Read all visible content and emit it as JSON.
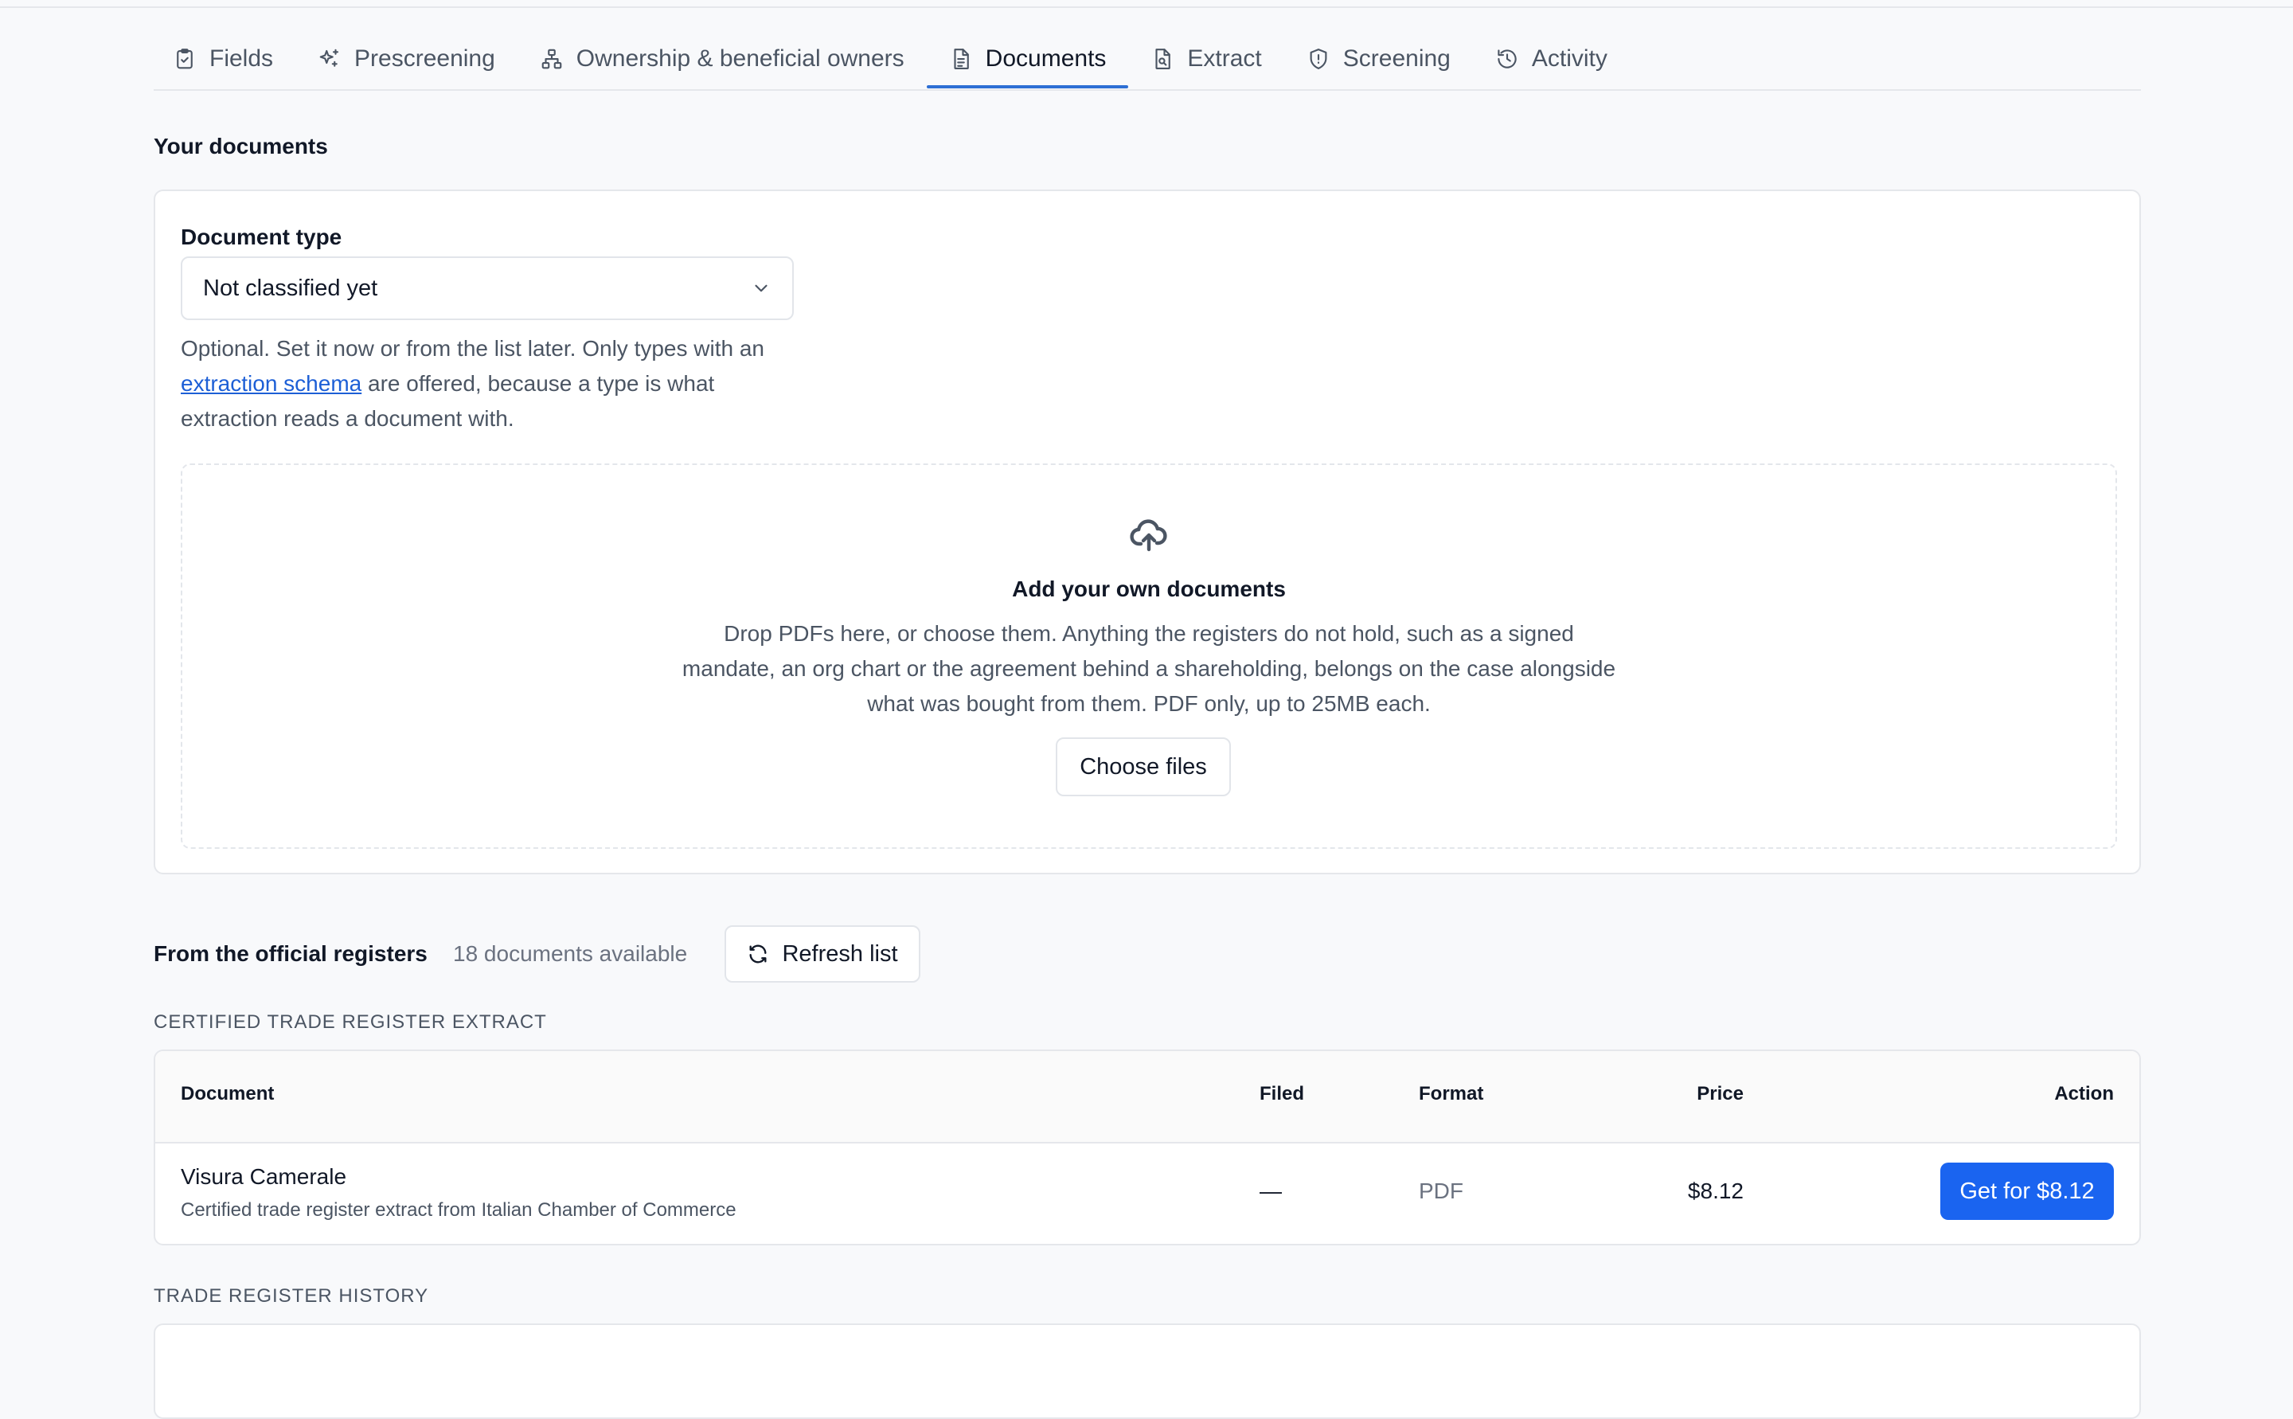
{
  "tabs": [
    {
      "label": "Fields"
    },
    {
      "label": "Prescreening"
    },
    {
      "label": "Ownership & beneficial owners"
    },
    {
      "label": "Documents"
    },
    {
      "label": "Extract"
    },
    {
      "label": "Screening"
    },
    {
      "label": "Activity"
    }
  ],
  "your_documents": {
    "title": "Your documents",
    "document_type_label": "Document type",
    "document_type_value": "Not classified yet",
    "help_before": "Optional. Set it now or from the list later. Only types with an ",
    "help_link": "extraction schema",
    "help_after": " are offered, because a type is what extraction reads a document with.",
    "dropzone": {
      "title": "Add your own documents",
      "text": "Drop PDFs here, or choose them. Anything the registers do not hold, such as a signed mandate, an org chart or the agreement behind a shareholding, belongs on the case alongside what was bought from them. PDF only, up to 25MB each.",
      "button": "Choose files"
    }
  },
  "registers": {
    "title": "From the official registers",
    "count": "18 documents available",
    "refresh_button": "Refresh list",
    "groups": [
      {
        "heading": "CERTIFIED TRADE REGISTER EXTRACT",
        "columns": {
          "document": "Document",
          "filed": "Filed",
          "format": "Format",
          "price": "Price",
          "action": "Action"
        },
        "rows": [
          {
            "name": "Visura Camerale",
            "description": "Certified trade register extract from Italian Chamber of Commerce",
            "filed": "—",
            "format": "PDF",
            "price": "$8.12",
            "action": "Get for $8.12"
          }
        ]
      },
      {
        "heading": "TRADE REGISTER HISTORY"
      }
    ]
  },
  "colors": {
    "accent": "#1a64f0",
    "active_tab_underline": "#2d6fd4",
    "link": "#1d5fd6"
  }
}
